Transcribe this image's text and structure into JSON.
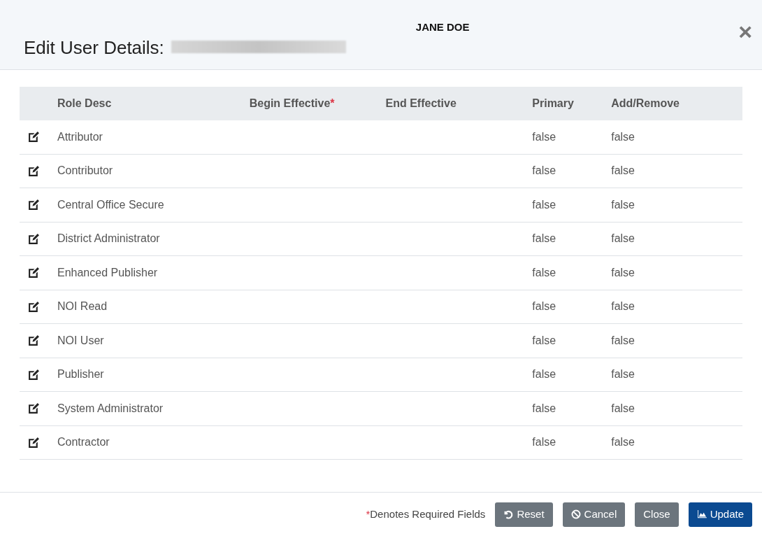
{
  "dialog": {
    "title": "Edit User Details:",
    "user_name": "JANE DOE",
    "close_icon": "×"
  },
  "table": {
    "columns": [
      {
        "label": "Role Desc"
      },
      {
        "label": "Begin Effective",
        "required_mark": "*"
      },
      {
        "label": "End Effective"
      },
      {
        "label": "Primary"
      },
      {
        "label": "Add/Remove"
      }
    ],
    "rows": [
      {
        "role": "Attributor",
        "primary": "false",
        "add_remove": "false"
      },
      {
        "role": "Contributor",
        "primary": "false",
        "add_remove": "false"
      },
      {
        "role": "Central Office Secure",
        "primary": "false",
        "add_remove": "false"
      },
      {
        "role": "District Administrator",
        "primary": "false",
        "add_remove": "false"
      },
      {
        "role": "Enhanced Publisher",
        "primary": "false",
        "add_remove": "false"
      },
      {
        "role": "NOI Read",
        "primary": "false",
        "add_remove": "false"
      },
      {
        "role": "NOI User",
        "primary": "false",
        "add_remove": "false"
      },
      {
        "role": "Publisher",
        "primary": "false",
        "add_remove": "false"
      },
      {
        "role": "System Administrator",
        "primary": "false",
        "add_remove": "false"
      },
      {
        "role": "Contractor",
        "primary": "false",
        "add_remove": "false"
      }
    ]
  },
  "footer": {
    "required_mark": "*",
    "note": "Denotes Required Fields",
    "buttons": [
      {
        "kind": "reset",
        "label": "Reset"
      },
      {
        "kind": "cancel",
        "label": "Cancel"
      },
      {
        "kind": "close",
        "label": "Close"
      },
      {
        "kind": "update",
        "label": "Update"
      }
    ]
  }
}
